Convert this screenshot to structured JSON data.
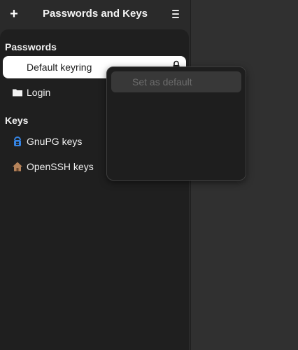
{
  "header": {
    "add_label": "+",
    "title": "Passwords and Keys"
  },
  "sidebar": {
    "sections": [
      {
        "title": "Passwords",
        "items": [
          {
            "label": "Default keyring",
            "icon": "keyring-icon",
            "selected": true
          },
          {
            "label": "Login",
            "icon": "folder-icon",
            "selected": false
          }
        ]
      },
      {
        "title": "Keys",
        "items": [
          {
            "label": "GnuPG keys",
            "icon": "gnupg-icon",
            "selected": false
          },
          {
            "label": "OpenSSH keys",
            "icon": "home-icon",
            "selected": false
          }
        ]
      }
    ]
  },
  "context_menu": {
    "items": [
      {
        "label": "Set as default",
        "enabled": false
      }
    ]
  },
  "colors": {
    "selected_row": "#ffffff",
    "sidebar_bg": "#1f1f1f",
    "gnupg_blue": "#3584e4",
    "home_brown": "#b5835a"
  }
}
